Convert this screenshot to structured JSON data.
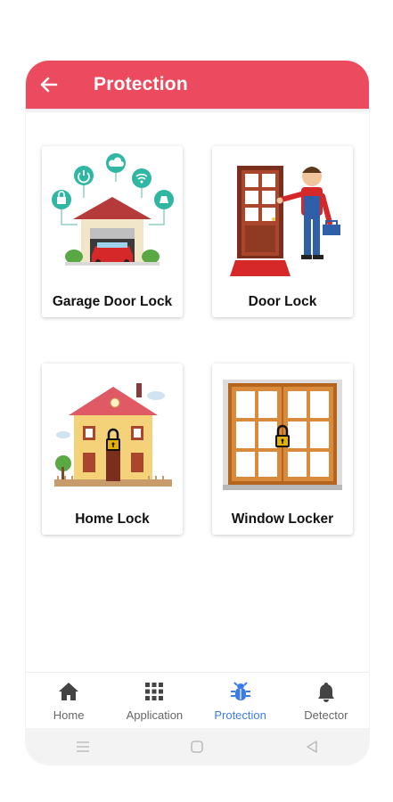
{
  "appbar": {
    "title": "Protection",
    "back_icon": "arrow-left-icon"
  },
  "colors": {
    "brand": "#ec4a5e",
    "active": "#3d7ce8",
    "inactive": "#666666"
  },
  "cards": [
    {
      "label": "Garage Door Lock",
      "image": "garage-door-lock-illustration"
    },
    {
      "label": "Door Lock",
      "image": "door-lock-illustration"
    },
    {
      "label": "Home Lock",
      "image": "home-lock-illustration"
    },
    {
      "label": "Window Locker",
      "image": "window-locker-illustration"
    }
  ],
  "bottom_nav": [
    {
      "label": "Home",
      "icon": "home-icon",
      "active": false
    },
    {
      "label": "Application",
      "icon": "grid-icon",
      "active": false
    },
    {
      "label": "Protection",
      "icon": "bug-icon",
      "active": true
    },
    {
      "label": "Detector",
      "icon": "bell-icon",
      "active": false
    }
  ],
  "system_nav": [
    "menu-icon",
    "home-square-icon",
    "back-triangle-icon"
  ]
}
